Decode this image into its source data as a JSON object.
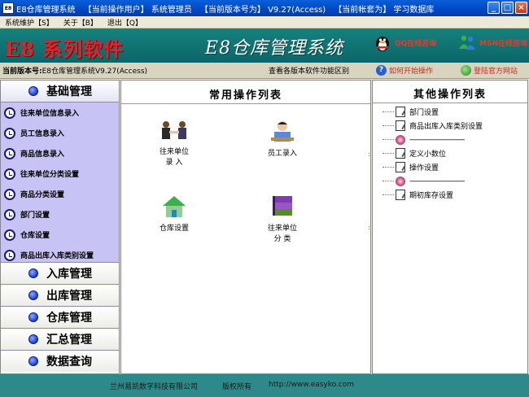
{
  "titlebar": {
    "app_icon_text": "E8",
    "app_title": "E8仓库管理系统",
    "segments": [
      {
        "label": "【当前操作用户】",
        "value": "系统管理员"
      },
      {
        "label": "【当前版本号为】",
        "value": "V9.27(Access)"
      },
      {
        "label": "【当前帐套为】",
        "value": "学习数据库"
      }
    ]
  },
  "menubar": {
    "items": [
      "系统维护【S】",
      "关于【B】",
      "退出【Q】"
    ]
  },
  "banner": {
    "brand": "E8 系列软件",
    "system_name": "E8仓库管理系统",
    "qq_support": "QQ在线咨询",
    "msn_support": "MSN在线咨询"
  },
  "infobar": {
    "version_label": "当前版本号:",
    "version_value": "E8仓库管理系统V9.27(Access)",
    "diff_link": "查看各版本软件功能区别",
    "howto_link": "如何开始操作",
    "official_link": "登陆官方网站"
  },
  "leftpanel": {
    "header": "基础管理",
    "items": [
      "往来单位信息录入",
      "员工信息录入",
      "商品信息录入",
      "往来单位分类设置",
      "商品分类设置",
      "部门设置",
      "仓库设置",
      "商品出库入库类别设置"
    ],
    "modules": [
      "入库管理",
      "出库管理",
      "仓库管理",
      "汇总管理",
      "数据查询"
    ]
  },
  "centerpanel": {
    "title": "常用操作列表",
    "ops": [
      {
        "label": "往来单位\n录 入",
        "icon": "handshake-icon"
      },
      {
        "label": "员工录入",
        "icon": "worker-icon"
      },
      {
        "label": "仓库设置",
        "icon": "house-icon"
      },
      {
        "label": "往来单位\n分 类",
        "icon": "books-icon"
      }
    ]
  },
  "rightpanel": {
    "title": "其他操作列表",
    "nodes": [
      {
        "type": "doc",
        "label": "部门设置"
      },
      {
        "type": "doc",
        "label": "商品出库入库类别设置"
      },
      {
        "type": "sep",
        "label": "------------------------------"
      },
      {
        "type": "doc",
        "label": "定义小数位"
      },
      {
        "type": "doc",
        "label": "操作设置"
      },
      {
        "type": "sep",
        "label": "------------------------------"
      },
      {
        "type": "doc",
        "label": "期初库存设置"
      }
    ]
  },
  "statusbar": {
    "company": "兰州易凯数字科技有限公司",
    "rights": "版权所有",
    "url": "http://www.easyko.com"
  },
  "colors": {
    "banner": "#0b6766",
    "left_list_bg": "#c7c3f4",
    "brand_red": "#e4202a",
    "status_bg": "#2e8a8a"
  }
}
